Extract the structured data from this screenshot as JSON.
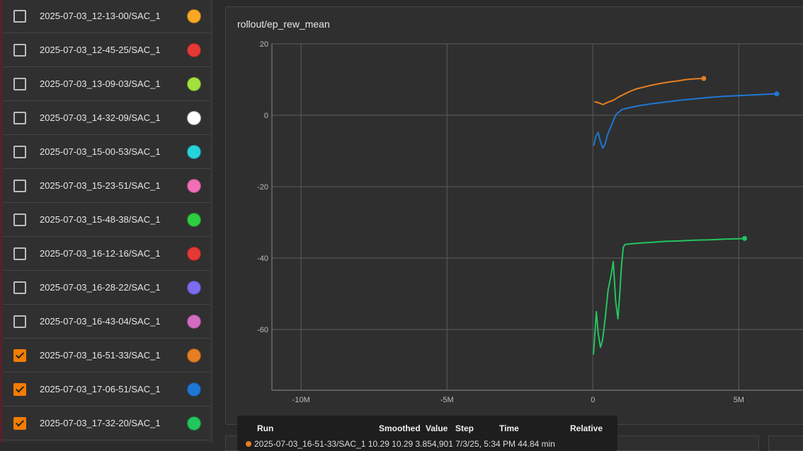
{
  "runs": [
    {
      "label": "2025-07-03_12-13-00/SAC_1",
      "color": "#f9a825",
      "checked": false
    },
    {
      "label": "2025-07-03_12-45-25/SAC_1",
      "color": "#e53935",
      "checked": false
    },
    {
      "label": "2025-07-03_13-09-03/SAC_1",
      "color": "#a4e040",
      "checked": false
    },
    {
      "label": "2025-07-03_14-32-09/SAC_1",
      "color": "#ffffff",
      "checked": false
    },
    {
      "label": "2025-07-03_15-00-53/SAC_1",
      "color": "#26d3da",
      "checked": false
    },
    {
      "label": "2025-07-03_15-23-51/SAC_1",
      "color": "#f06fb6",
      "checked": false
    },
    {
      "label": "2025-07-03_15-48-38/SAC_1",
      "color": "#2ecc40",
      "checked": false
    },
    {
      "label": "2025-07-03_16-12-16/SAC_1",
      "color": "#e53935",
      "checked": false
    },
    {
      "label": "2025-07-03_16-28-22/SAC_1",
      "color": "#7b6cf0",
      "checked": false
    },
    {
      "label": "2025-07-03_16-43-04/SAC_1",
      "color": "#d36cc0",
      "checked": false
    },
    {
      "label": "2025-07-03_16-51-33/SAC_1",
      "color": "#e67e22",
      "checked": true
    },
    {
      "label": "2025-07-03_17-06-51/SAC_1",
      "color": "#1f77d4",
      "checked": true
    },
    {
      "label": "2025-07-03_17-32-20/SAC_1",
      "color": "#22c55e",
      "checked": true
    }
  ],
  "chart_data": {
    "type": "line",
    "title": "rollout/ep_rew_mean",
    "xlabel": "",
    "ylabel": "",
    "xlim": [
      -11000000,
      7200000
    ],
    "ylim": [
      -77,
      20
    ],
    "x_ticks": [
      {
        "v": -10000000,
        "label": "-10M"
      },
      {
        "v": -5000000,
        "label": "-5M"
      },
      {
        "v": 0,
        "label": "0"
      },
      {
        "v": 5000000,
        "label": "5M"
      }
    ],
    "y_ticks": [
      {
        "v": 20,
        "label": "20"
      },
      {
        "v": 0,
        "label": "0"
      },
      {
        "v": -20,
        "label": "-20"
      },
      {
        "v": -40,
        "label": "-40"
      },
      {
        "v": -60,
        "label": "-60"
      }
    ],
    "grid": true,
    "series": [
      {
        "color": "#e67e22",
        "x": [
          50000,
          200000,
          350000,
          500000,
          700000,
          900000,
          1100000,
          1300000,
          1500000,
          1700000,
          2000000,
          2300000,
          2600000,
          2900000,
          3200000,
          3500000,
          3800000
        ],
        "y": [
          3.8,
          3.5,
          3.0,
          3.6,
          4.2,
          5.2,
          6.0,
          6.8,
          7.4,
          7.8,
          8.4,
          8.9,
          9.3,
          9.6,
          10.0,
          10.2,
          10.3
        ]
      },
      {
        "color": "#1f77d4",
        "x": [
          30000,
          100000,
          180000,
          260000,
          340000,
          420000,
          500000,
          600000,
          700000,
          800000,
          1000000,
          1300000,
          1600000,
          2000000,
          2500000,
          3000000,
          3500000,
          4000000,
          4500000,
          5000000,
          5500000,
          6000000,
          6300000
        ],
        "y": [
          -8.5,
          -6.0,
          -4.8,
          -7.5,
          -9.2,
          -8.0,
          -5.5,
          -3.5,
          -1.5,
          0.3,
          1.6,
          2.2,
          2.7,
          3.2,
          3.7,
          4.2,
          4.6,
          5.0,
          5.3,
          5.5,
          5.7,
          5.9,
          6.0
        ]
      },
      {
        "color": "#22c55e",
        "x": [
          20000,
          60000,
          120000,
          180000,
          260000,
          330000,
          420000,
          520000,
          620000,
          700000,
          780000,
          860000,
          920000,
          980000,
          1040000,
          1100000,
          1300000,
          1600000,
          2000000,
          2500000,
          3000000,
          3500000,
          4000000,
          4500000,
          5000000,
          5200000
        ],
        "y": [
          -67,
          -62,
          -55,
          -61,
          -65,
          -63,
          -57,
          -49,
          -45,
          -41,
          -52,
          -57,
          -50,
          -42,
          -37,
          -36.2,
          -36.0,
          -35.8,
          -35.6,
          -35.3,
          -35.2,
          -35.0,
          -34.9,
          -34.7,
          -34.6,
          -34.5
        ]
      }
    ]
  },
  "tooltip": {
    "headers": [
      "Run",
      "Smoothed",
      "Value",
      "Step",
      "Time",
      "Relative"
    ],
    "row_partial": "2025-07-03_16-51-33/SAC_1   10.29   10.29   3.854,901   7/3/25, 5:34 PM   44.84 min"
  }
}
